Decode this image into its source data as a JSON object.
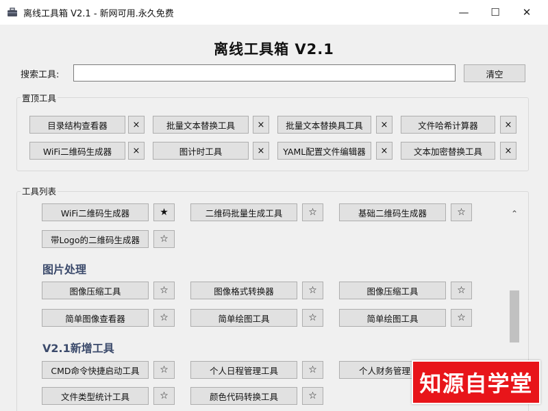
{
  "window": {
    "title": "离线工具箱 V2.1 - 新网可用.永久免费",
    "minimize_glyph": "—",
    "maximize_glyph": "☐",
    "close_glyph": "✕"
  },
  "heading": "离线工具箱 V2.1",
  "search": {
    "label": "搜索工具:",
    "value": "",
    "placeholder": "",
    "clear_label": "清空"
  },
  "pinned": {
    "title": "置顶工具",
    "remove_glyph": "×",
    "items": [
      {
        "label": "目录结构查看器"
      },
      {
        "label": "批量文本替换工具"
      },
      {
        "label": "批量文本替换具工具"
      },
      {
        "label": "文件哈希计算器"
      },
      {
        "label": "WiFi二维码生成器"
      },
      {
        "label": "图计时工具"
      },
      {
        "label": "YAML配置文件编辑器"
      },
      {
        "label": "文本加密替换工具"
      }
    ]
  },
  "tool_list": {
    "title": "工具列表",
    "star_filled": "★",
    "star_empty": "☆",
    "scroll_up_glyph": "⌃",
    "rows": [
      {
        "label": "WiFi二维码生成器",
        "starred": true
      },
      {
        "label": "二维码批量生成工具",
        "starred": false
      },
      {
        "label": "基础二维码生成器",
        "starred": false
      },
      {
        "label": "带Logo的二维码生成器",
        "starred": false
      }
    ],
    "sections": [
      {
        "heading": "图片处理",
        "items": [
          {
            "label": "图像压缩工具",
            "starred": false
          },
          {
            "label": "图像格式转换器",
            "starred": false
          },
          {
            "label": "图像压缩工具",
            "starred": false
          },
          {
            "label": "简单图像查看器",
            "starred": false
          },
          {
            "label": "简单绘图工具",
            "starred": false
          },
          {
            "label": "简单绘图工具",
            "starred": false
          }
        ]
      },
      {
        "heading": "V2.1新增工具",
        "items": [
          {
            "label": "CMD命令快捷启动工具",
            "starred": false
          },
          {
            "label": "个人日程管理工具",
            "starred": false
          },
          {
            "label": "个人财务管理",
            "starred": false
          },
          {
            "label": "文件类型统计工具",
            "starred": false
          },
          {
            "label": "颜色代码转换工具",
            "starred": false
          }
        ]
      }
    ]
  },
  "watermark": "知源自学堂",
  "icons": {
    "app": "toolbox-icon"
  },
  "colors": {
    "section_heading": "#3b4a6b",
    "watermark_bg": "#e8151a",
    "button_bg": "#e1e1e1"
  }
}
